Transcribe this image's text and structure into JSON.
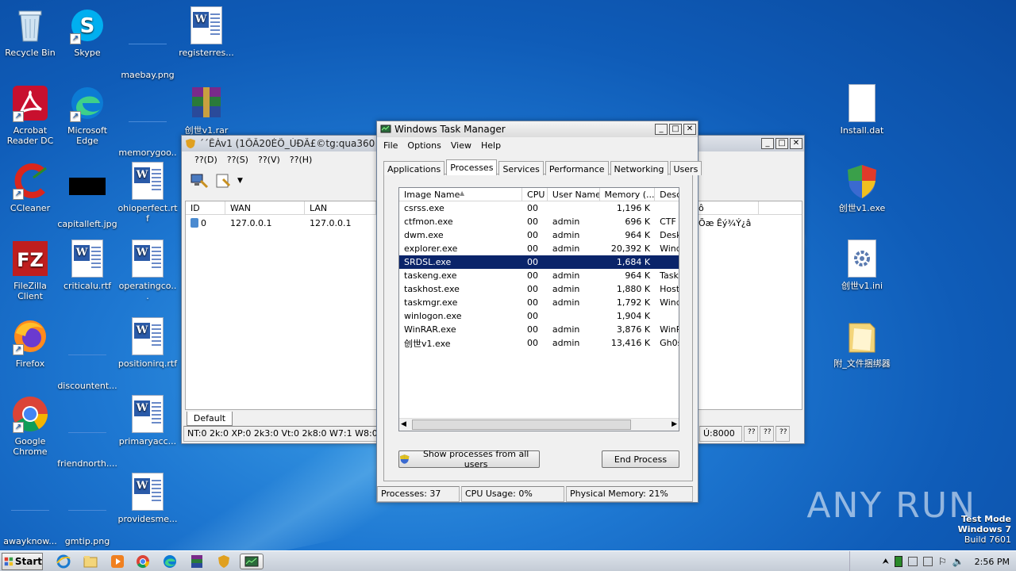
{
  "desktop": {
    "icons_col1": [
      {
        "label": "Recycle Bin"
      },
      {
        "label": "Acrobat Reader DC"
      },
      {
        "label": "CCleaner"
      },
      {
        "label": "FileZilla Client"
      },
      {
        "label": "Firefox"
      },
      {
        "label": "Google Chrome"
      },
      {
        "label": "awayknow..."
      }
    ],
    "icons_col2": [
      {
        "label": "Skype"
      },
      {
        "label": "Microsoft Edge"
      },
      {
        "label": "capitalleft.jpg"
      },
      {
        "label": "criticalu.rtf"
      },
      {
        "label": "discountent..."
      },
      {
        "label": "friendnorth...."
      },
      {
        "label": "gmtip.png"
      }
    ],
    "icons_col3": [
      {
        "label": "maebay.png"
      },
      {
        "label": "memorygoo..."
      },
      {
        "label": "ohioperfect.rtf"
      },
      {
        "label": "operatingco..."
      },
      {
        "label": "positionirq.rtf"
      },
      {
        "label": "primaryacc..."
      },
      {
        "label": "providesme..."
      }
    ],
    "icons_col4": [
      {
        "label": "registerres..."
      },
      {
        "label": "创世v1.rar"
      }
    ],
    "icons_right": [
      {
        "label": "Install.dat"
      },
      {
        "label": "创世v1.exe"
      },
      {
        "label": "创世v1.ini"
      },
      {
        "label": "附_文件捆绑器"
      }
    ]
  },
  "rat_window": {
    "title": "´´ÊÀv1 (1ÕÂ20ÈÕ_ÚÐÂ£©tg:qua360",
    "menu": [
      "??(D)",
      "??(S)",
      "??(V)",
      "??(H)"
    ],
    "columns": [
      "ID",
      "WAN",
      "LAN"
    ],
    "row": {
      "id": "0",
      "wan": "127.0.0.1",
      "lan": "127.0.0.1",
      "extra": "Õæ Êý¾Ý¿â"
    },
    "tab": "Default",
    "status": "NT:0 2k:0 XP:0 2k3:0 Vt:0 2k8:0 W7:1 W8:0 2k12",
    "status_port": "Ú:8000",
    "status_q": [
      "??",
      "??",
      "??"
    ],
    "header_fragment": "ô"
  },
  "task_manager": {
    "title": "Windows Task Manager",
    "menu": [
      "File",
      "Options",
      "View",
      "Help"
    ],
    "tabs": [
      "Applications",
      "Processes",
      "Services",
      "Performance",
      "Networking",
      "Users"
    ],
    "selected_tab": "Processes",
    "columns": [
      "Image Name",
      "CPU",
      "User Name",
      "Memory (...",
      "Desc"
    ],
    "rows": [
      {
        "name": "csrss.exe",
        "cpu": "00",
        "user": "",
        "mem": "1,196 K",
        "desc": ""
      },
      {
        "name": "ctfmon.exe",
        "cpu": "00",
        "user": "admin",
        "mem": "696 K",
        "desc": "CTF I"
      },
      {
        "name": "dwm.exe",
        "cpu": "00",
        "user": "admin",
        "mem": "964 K",
        "desc": "Desk"
      },
      {
        "name": "explorer.exe",
        "cpu": "00",
        "user": "admin",
        "mem": "20,392 K",
        "desc": "Wind"
      },
      {
        "name": "SRDSL.exe",
        "cpu": "00",
        "user": "",
        "mem": "1,684 K",
        "desc": ""
      },
      {
        "name": "taskeng.exe",
        "cpu": "00",
        "user": "admin",
        "mem": "964 K",
        "desc": "Task"
      },
      {
        "name": "taskhost.exe",
        "cpu": "00",
        "user": "admin",
        "mem": "1,880 K",
        "desc": "Host"
      },
      {
        "name": "taskmgr.exe",
        "cpu": "00",
        "user": "admin",
        "mem": "1,792 K",
        "desc": "Wind"
      },
      {
        "name": "winlogon.exe",
        "cpu": "00",
        "user": "",
        "mem": "1,904 K",
        "desc": ""
      },
      {
        "name": "WinRAR.exe",
        "cpu": "00",
        "user": "admin",
        "mem": "3,876 K",
        "desc": "WinR"
      },
      {
        "name": "创世v1.exe",
        "cpu": "00",
        "user": "admin",
        "mem": "13,416 K",
        "desc": "Gh0s"
      }
    ],
    "selected_row": 4,
    "show_all_button": "Show processes from all users",
    "end_process_button": "End Process",
    "status": {
      "processes": "Processes: 37",
      "cpu": "CPU Usage: 0%",
      "memory": "Physical Memory: 21%"
    }
  },
  "taskbar": {
    "start_label": "Start",
    "clock": "2:56 PM"
  },
  "watermark": {
    "brand": "ANY RUN",
    "line1": "Test Mode",
    "line2": "Windows 7",
    "line3": "Build 7601"
  },
  "colors": {
    "selection": "#0a246a",
    "desktop": "#1e78d2"
  }
}
